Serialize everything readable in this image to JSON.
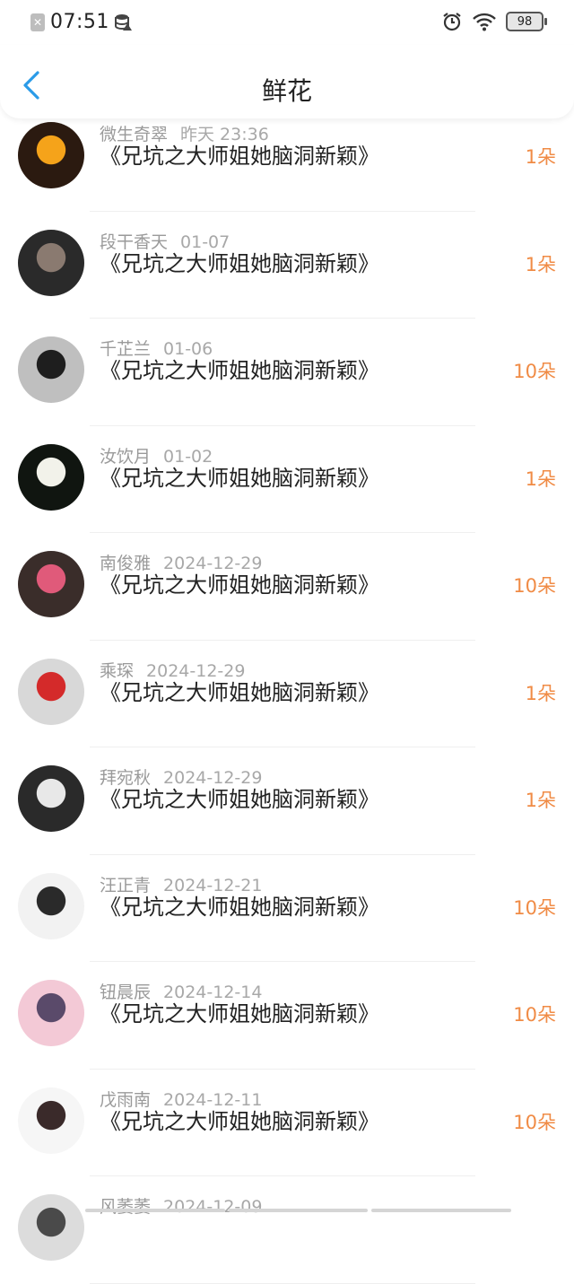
{
  "status_bar": {
    "time": "07:51",
    "battery": "98"
  },
  "header": {
    "title": "鲜花"
  },
  "gifts": [
    {
      "user": "微生奇翠",
      "date": "昨天 23:36",
      "book": "《兄坑之大师姐她脑洞新颖》",
      "count": "1朵",
      "avatar_icon": "pumpkin-avatar-icon",
      "avatar_color": "#2b1a10",
      "avatar_accent": "#f5a31a"
    },
    {
      "user": "段干香天",
      "date": "01-07",
      "book": "《兄坑之大师姐她脑洞新颖》",
      "count": "1朵",
      "avatar_icon": "person-avatar-icon",
      "avatar_color": "#2a2a2a",
      "avatar_accent": "#8a7a70"
    },
    {
      "user": "千芷兰",
      "date": "01-06",
      "book": "《兄坑之大师姐她脑洞新颖》",
      "count": "10朵",
      "avatar_icon": "girl-avatar-icon",
      "avatar_color": "#bfbfbf",
      "avatar_accent": "#1e1e1e"
    },
    {
      "user": "汝饮月",
      "date": "01-02",
      "book": "《兄坑之大师姐她脑洞新颖》",
      "count": "1朵",
      "avatar_icon": "lotus-avatar-icon",
      "avatar_color": "#101510",
      "avatar_accent": "#f2f2ea"
    },
    {
      "user": "南俊雅",
      "date": "2024-12-29",
      "book": "《兄坑之大师姐她脑洞新颖》",
      "count": "10朵",
      "avatar_icon": "bottles-avatar-icon",
      "avatar_color": "#3a2d2a",
      "avatar_accent": "#e05a7a"
    },
    {
      "user": "乘琛",
      "date": "2024-12-29",
      "book": "《兄坑之大师姐她脑洞新颖》",
      "count": "1朵",
      "avatar_icon": "red-hoodie-avatar-icon",
      "avatar_color": "#d8d8d8",
      "avatar_accent": "#d42a2a"
    },
    {
      "user": "拜宛秋",
      "date": "2024-12-29",
      "book": "《兄坑之大师姐她脑洞新颖》",
      "count": "1朵",
      "avatar_icon": "dark-person-avatar-icon",
      "avatar_color": "#2a2a2a",
      "avatar_accent": "#e8e8e8"
    },
    {
      "user": "汪正青",
      "date": "2024-12-21",
      "book": "《兄坑之大师姐她脑洞新颖》",
      "count": "10朵",
      "avatar_icon": "boy-avatar-icon",
      "avatar_color": "#f2f2f2",
      "avatar_accent": "#2a2a2a"
    },
    {
      "user": "钮晨辰",
      "date": "2024-12-14",
      "book": "《兄坑之大师姐她脑洞新颖》",
      "count": "10朵",
      "avatar_icon": "anime-avatar-icon",
      "avatar_color": "#f3c9d6",
      "avatar_accent": "#5a4a6a"
    },
    {
      "user": "戊雨南",
      "date": "2024-12-11",
      "book": "《兄坑之大师姐她脑洞新颖》",
      "count": "10朵",
      "avatar_icon": "girl-white-avatar-icon",
      "avatar_color": "#f6f6f6",
      "avatar_accent": "#3a2a2a"
    },
    {
      "user": "风萎萎",
      "date": "2024-12-09",
      "book": "",
      "count": "",
      "avatar_icon": "girl-avatar-icon",
      "avatar_color": "#dcdcdc",
      "avatar_accent": "#4a4a4a"
    }
  ]
}
